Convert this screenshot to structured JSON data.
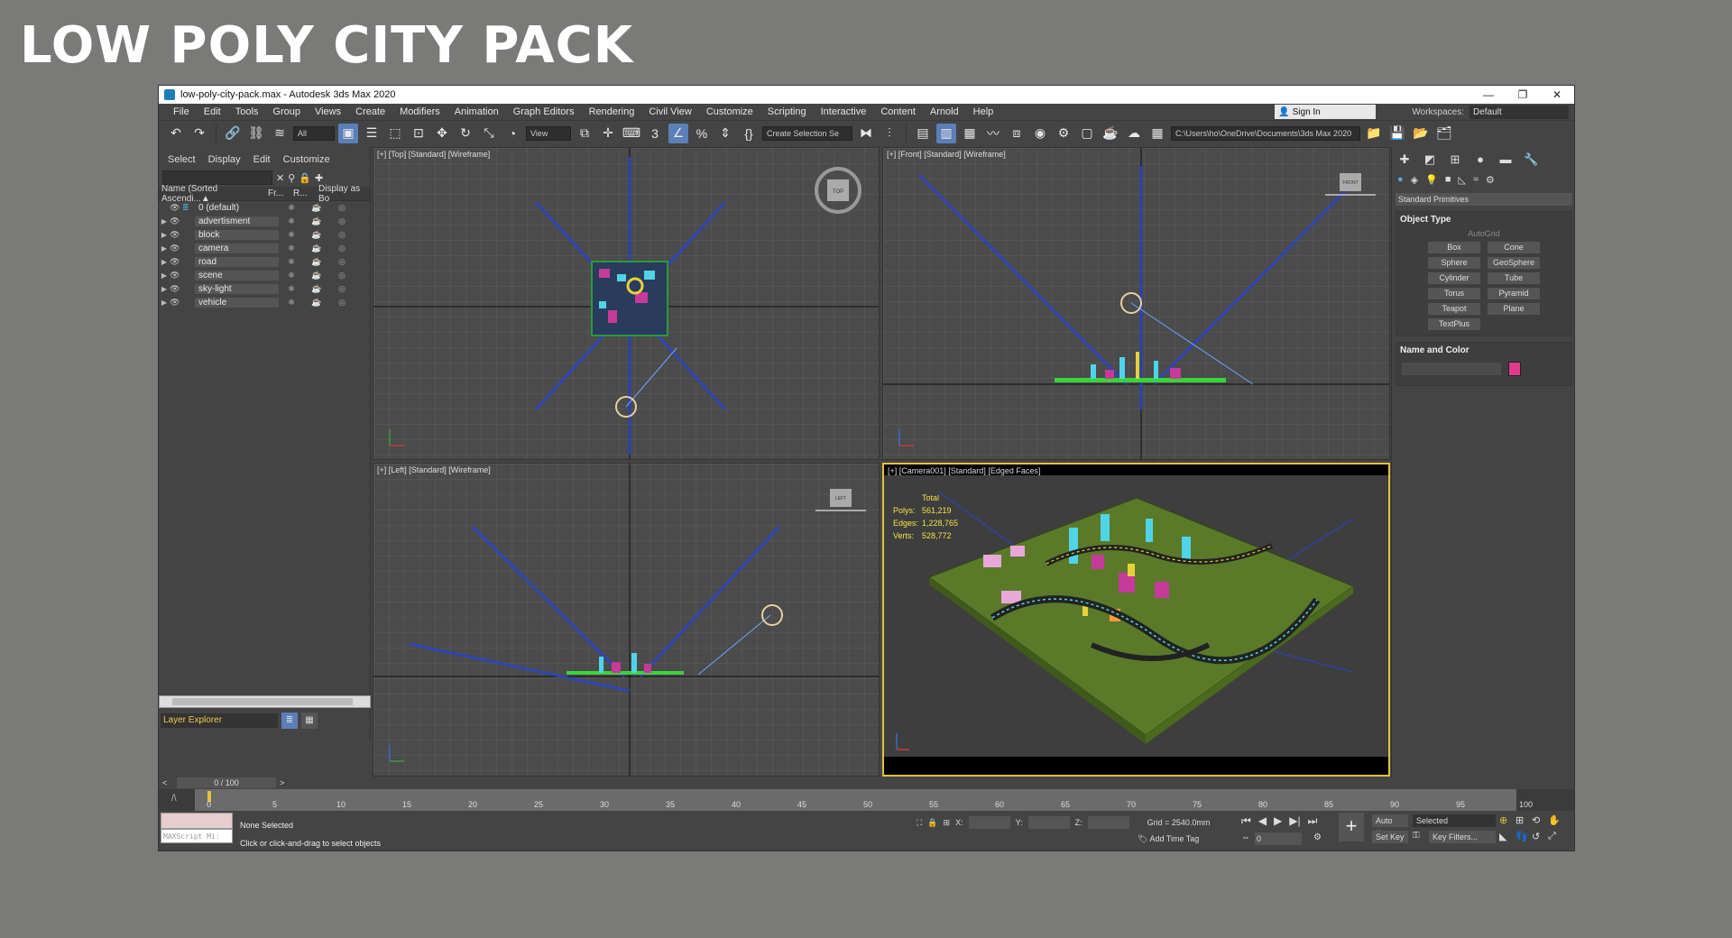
{
  "banner": "LOW POLY CITY PACK",
  "window": {
    "title": "low-poly-city-pack.max - Autodesk 3ds Max 2020",
    "controls": [
      "—",
      "❐",
      "✕"
    ]
  },
  "menu": {
    "items": [
      "File",
      "Edit",
      "Tools",
      "Group",
      "Views",
      "Create",
      "Modifiers",
      "Animation",
      "Graph Editors",
      "Rendering",
      "Civil View",
      "Customize",
      "Scripting",
      "Interactive",
      "Content",
      "Arnold",
      "Help"
    ],
    "sign_in": "Sign In",
    "workspaces_label": "Workspaces:",
    "workspace_value": "Default"
  },
  "toolbar": {
    "filter_value": "All",
    "coord_value": "View",
    "selection_set": "Create Selection Se",
    "path": "C:\\Users\\ho\\OneDrive\\Documents\\3ds Max 2020"
  },
  "explorer": {
    "tabs": [
      "Select",
      "Display",
      "Edit",
      "Customize"
    ],
    "columns": [
      "Name (Sorted Ascendi...▲",
      "Fr...",
      "R...",
      "Display as Bo"
    ],
    "layers": [
      "0 (default)",
      "advertisment",
      "block",
      "camera",
      "road",
      "scene",
      "sky-light",
      "vehicle"
    ],
    "footer": "Layer Explorer"
  },
  "viewports": {
    "top": "[+] [Top] [Standard] [Wireframe]",
    "front": "[+] [Front] [Standard] [Wireframe]",
    "left": "[+] [Left] [Standard] [Wireframe]",
    "camera": "[+] [Camera001] [Standard] [Edged Faces]",
    "viewcube_top": "TOP",
    "viewcube_front": "FRONT",
    "viewcube_left": "LEFT",
    "stats": {
      "header": "Total",
      "polys_label": "Polys:",
      "polys": "561,219",
      "edges_label": "Edges:",
      "edges": "1,228,765",
      "verts_label": "Verts:",
      "verts": "528,772"
    }
  },
  "command_panel": {
    "category": "Standard Primitives",
    "object_type_title": "Object Type",
    "autogrid": "AutoGrid",
    "primitives": [
      "Box",
      "Cone",
      "Sphere",
      "GeoSphere",
      "Cylinder",
      "Tube",
      "Torus",
      "Pyramid",
      "Teapot",
      "Plane",
      "TextPlus"
    ],
    "name_color_title": "Name and Color",
    "color": "#e03a8b"
  },
  "timeline": {
    "frame": "0 / 100",
    "ticks": [
      "0",
      "5",
      "10",
      "15",
      "20",
      "25",
      "30",
      "35",
      "40",
      "45",
      "50",
      "55",
      "60",
      "65",
      "70",
      "75",
      "80",
      "85",
      "90",
      "95",
      "100"
    ]
  },
  "status": {
    "maxscript": "MAXScript Mi:",
    "selection": "None Selected",
    "prompt": "Click or click-and-drag to select objects",
    "x_label": "X:",
    "y_label": "Y:",
    "z_label": "Z:",
    "grid": "Grid = 2540.0mm",
    "add_time_tag": "Add Time Tag",
    "frame_value": "0",
    "auto_key": "Auto Key",
    "selected": "Selected",
    "set_key": "Set Key",
    "key_filters": "Key Filters..."
  }
}
